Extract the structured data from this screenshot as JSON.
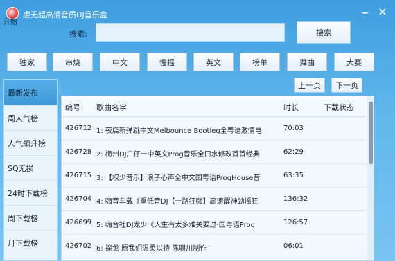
{
  "window": {
    "title": "虐无超高清音质DJ音乐盒",
    "start_label": "开始"
  },
  "search": {
    "label": "搜索:",
    "value": "",
    "button_label": "搜索"
  },
  "categories": [
    "独家",
    "串烧",
    "中文",
    "慢摇",
    "英文",
    "榜单",
    "舞曲",
    "大赛"
  ],
  "sidebar": {
    "items": [
      "最新发布",
      "周人气榜",
      "人气飙升榜",
      "SQ无损",
      "24时下载榜",
      "周下载榜",
      "月下载榜"
    ],
    "active_index": 0
  },
  "pager": {
    "prev_label": "上一页",
    "next_label": "下一页"
  },
  "table": {
    "headers": {
      "id": "编号",
      "name": "歌曲名字",
      "duration": "时长",
      "status": "下载状态"
    },
    "rows": [
      {
        "id": "426712",
        "name": "1: 夜店新弹跳中文Melbounce Bootleg全粤语激情电",
        "duration": "70:03",
        "status": ""
      },
      {
        "id": "426728",
        "name": "2: 梅州DJ广仔一中英文Prog音乐全口水修改首首经典",
        "duration": "62:29",
        "status": ""
      },
      {
        "id": "426715",
        "name": "3: 【权少音乐】浪子心声全中文国粤语ProgHouse音",
        "duration": "63:35",
        "status": ""
      },
      {
        "id": "426704",
        "name": "4: 嗨音车载《重低音DJ【一路狂嗨】高速醒神劲摇狂",
        "duration": "136:32",
        "status": ""
      },
      {
        "id": "426699",
        "name": "5: 嗨音社DJ龙少《人生有太多难关要过·国粤语Prog",
        "duration": "126:57",
        "status": ""
      },
      {
        "id": "426702",
        "name": "6: 探戈    愿我们温柔以待  陈骐川制作",
        "duration": "06:01",
        "status": ""
      }
    ]
  },
  "colors": {
    "window_bg": "#62b7ec",
    "sidebar_active": "#4aa3e0",
    "panel_bg": "#f2f8fd"
  }
}
